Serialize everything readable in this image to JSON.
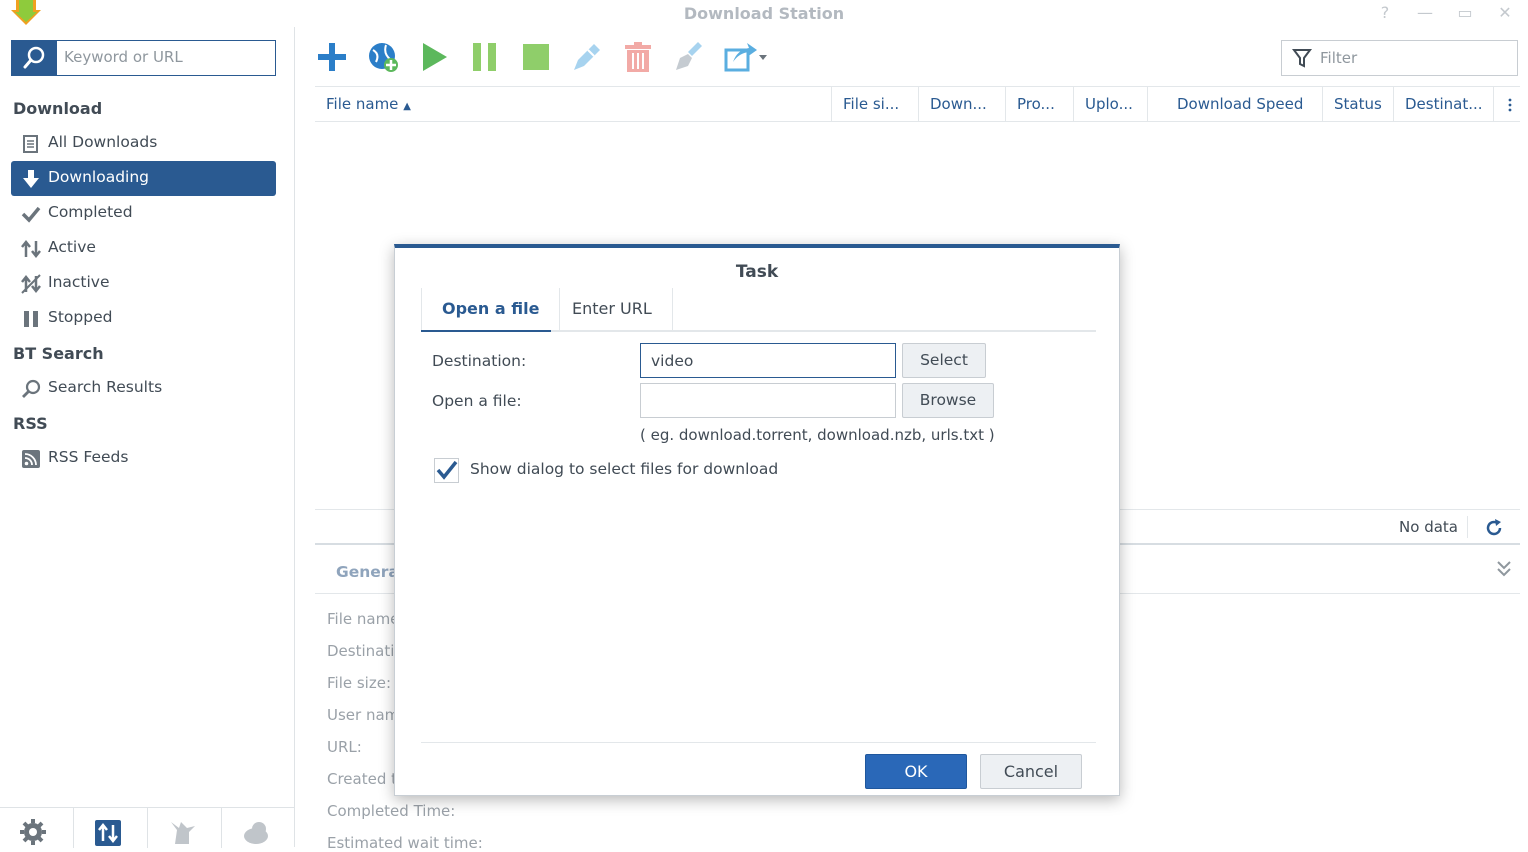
{
  "window": {
    "title": "Download Station"
  },
  "sidebar": {
    "search_placeholder": "Keyword or URL",
    "sections": {
      "download": "Download",
      "bt_search": "BT Search",
      "rss": "RSS"
    },
    "items": {
      "all_downloads": "All Downloads",
      "downloading": "Downloading",
      "completed": "Completed",
      "active": "Active",
      "inactive": "Inactive",
      "stopped": "Stopped",
      "search_results": "Search Results",
      "rss_feeds": "RSS Feeds"
    },
    "selected": "downloading"
  },
  "toolbar": {
    "filter_placeholder": "Filter",
    "icons": [
      "add-icon",
      "add-url-icon",
      "resume-icon",
      "pause-icon",
      "stop-icon",
      "edit-icon",
      "delete-icon",
      "clear-icon",
      "share-icon"
    ]
  },
  "grid": {
    "columns": [
      "File name",
      "File si...",
      "Down...",
      "Pro...",
      "Uplo...",
      "Download Speed",
      "Status",
      "Destinat..."
    ],
    "sort_indicator": "▲",
    "status": "No data"
  },
  "details": {
    "tab": "Genera",
    "labels": [
      "File name",
      "Destinati",
      "File size:",
      "User nam",
      "URL:",
      "Created t",
      "Completed Time:",
      "Estimated wait time:"
    ]
  },
  "dialog": {
    "title": "Task",
    "tabs": {
      "open_file": "Open a file",
      "enter_url": "Enter URL"
    },
    "destination_label": "Destination:",
    "destination_value": "video",
    "select_button": "Select",
    "open_file_label": "Open a file:",
    "open_file_value": "",
    "browse_button": "Browse",
    "hint": "( eg. download.torrent, download.nzb, urls.txt )",
    "checkbox_label": "Show dialog to select files for download",
    "checkbox_checked": true,
    "ok_button": "OK",
    "cancel_button": "Cancel"
  },
  "colors": {
    "accent": "#2a5a91",
    "ok_button": "#2a68b8",
    "play_green": "#5cb85c",
    "delete_red": "#e8837e",
    "edit_blue": "#5aaee0"
  }
}
